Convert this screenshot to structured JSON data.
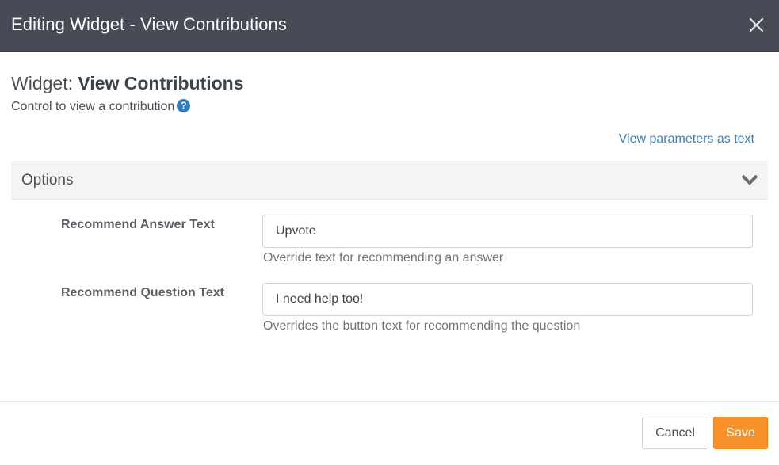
{
  "header": {
    "title": "Editing Widget - View Contributions"
  },
  "widget": {
    "prefix": "Widget:",
    "name": "View Contributions",
    "description": "Control to view a contribution"
  },
  "links": {
    "view_params": "View parameters as text"
  },
  "options": {
    "title": "Options",
    "fields": [
      {
        "label": "Recommend Answer Text",
        "value": "Upvote",
        "help": "Override text for recommending an answer"
      },
      {
        "label": "Recommend Question Text",
        "value": "I need help too!",
        "help": "Overrides the button text for recommending the question"
      }
    ]
  },
  "footer": {
    "cancel_label": "Cancel",
    "save_label": "Save"
  },
  "colors": {
    "header_bg": "#474b56",
    "link": "#3a7fbd",
    "help_icon": "#2f7dc3",
    "save_button": "#f7922a"
  }
}
